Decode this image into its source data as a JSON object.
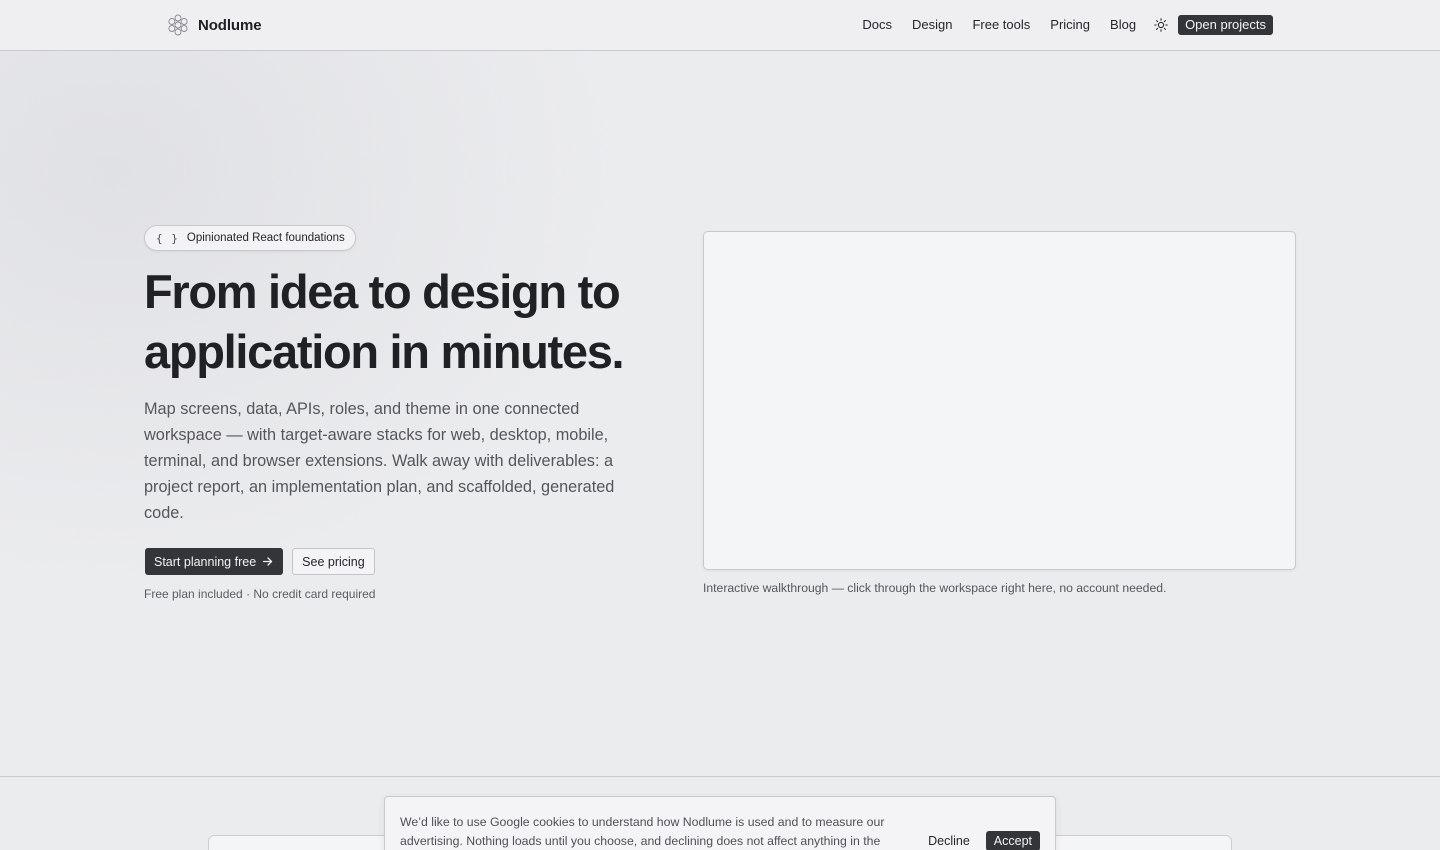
{
  "nav": {
    "brand": "Nodlume",
    "links": [
      "Docs",
      "Design",
      "Free tools",
      "Pricing",
      "Blog"
    ],
    "theme_icon": "sun-icon",
    "cta": "Open projects"
  },
  "hero": {
    "badge_icon": "{ }",
    "badge": "Opinionated React foundations",
    "headline": "From idea to design to application in minutes.",
    "subtext": "Map screens, data, APIs, roles, and theme in one connected workspace — with target-aware stacks for web, desktop, mobile, terminal, and browser extensions. Walk away with deliverables: a project report, an implementation plan, and scaffolded, generated code.",
    "primary_cta": "Start planning free",
    "secondary_cta": "See pricing",
    "fineprint": "Free plan included · No credit card required",
    "preview_caption": "Interactive walkthrough — click through the workspace right here, no account needed."
  },
  "cookie": {
    "text": "We’d like to use Google cookies to understand how Nodlume is used and to measure our advertising. Nothing loads until you choose, and declining does not affect anything in the",
    "decline": "Decline",
    "accept": "Accept"
  },
  "colors": {
    "background": "#ebecee",
    "primary": "#333538",
    "text": "#1f2023",
    "muted": "#55565b"
  }
}
